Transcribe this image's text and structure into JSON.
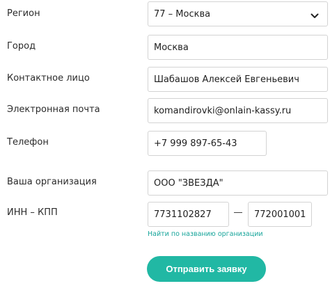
{
  "form": {
    "region": {
      "label": "Регион",
      "value": "77 – Москва"
    },
    "city": {
      "label": "Город",
      "value": "Москва"
    },
    "contact": {
      "label": "Контактное лицо",
      "value": "Шабашов Алексей Евгеньевич"
    },
    "email": {
      "label": "Электронная почта",
      "value": "komandirovki@onlain-kassy.ru"
    },
    "phone": {
      "label": "Телефон",
      "value": "+7 999 897-65-43"
    },
    "organization": {
      "label": "Ваша организация",
      "value": "ООО \"ЗВЕЗДА\""
    },
    "inn_kpp": {
      "label": "ИНН – КПП",
      "inn": "7731102827",
      "kpp": "772001001"
    },
    "find_link": "Найти по названию организации",
    "submit_label": "Отправить заявку"
  },
  "colors": {
    "accent": "#21b8a4",
    "link": "#16a49a",
    "border": "#d3d3d3"
  },
  "icons": {
    "region_dropdown": "chevron-down-icon"
  }
}
